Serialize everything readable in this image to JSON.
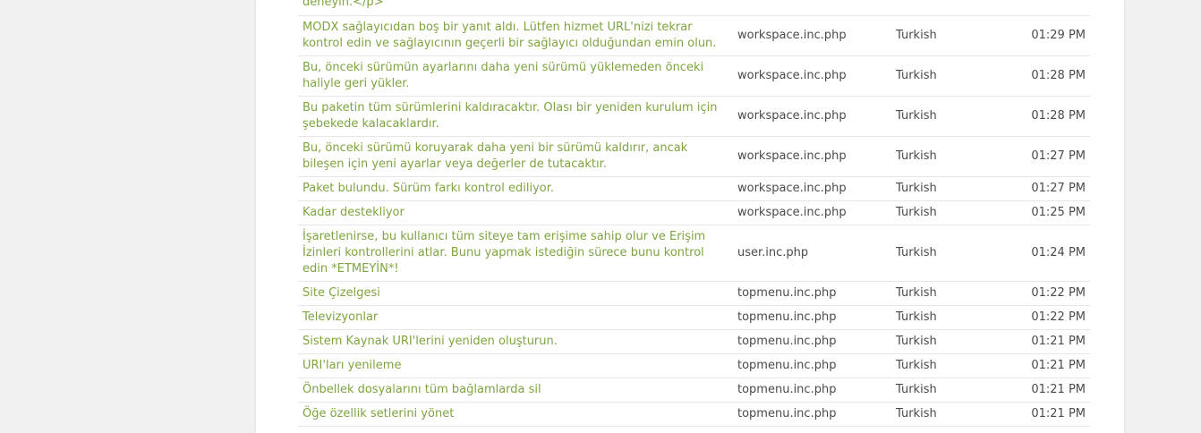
{
  "rows": [
    {
      "text": "deneyin.</p>",
      "file": "",
      "lang": "",
      "time": ""
    },
    {
      "text": "MODX sağlayıcıdan boş bir yanıt aldı. Lütfen hizmet URL'nizi tekrar kontrol edin ve sağlayıcının geçerli bir sağlayıcı olduğundan emin olun.",
      "file": "workspace.inc.php",
      "lang": "Turkish",
      "time": "01:29 PM"
    },
    {
      "text": "Bu, önceki sürümün ayarlarını daha yeni sürümü yüklemeden önceki haliyle geri yükler.",
      "file": "workspace.inc.php",
      "lang": "Turkish",
      "time": "01:28 PM"
    },
    {
      "text": "Bu paketin tüm sürümlerini kaldıracaktır. Olası bir yeniden kurulum için şebekede kalacaklardır.",
      "file": "workspace.inc.php",
      "lang": "Turkish",
      "time": "01:28 PM"
    },
    {
      "text": "Bu, önceki sürümü koruyarak daha yeni bir sürümü kaldırır, ancak bileşen için yeni ayarlar veya değerler de tutacaktır.",
      "file": "workspace.inc.php",
      "lang": "Turkish",
      "time": "01:27 PM"
    },
    {
      "text": "Paket bulundu. Sürüm farkı kontrol ediliyor.",
      "file": "workspace.inc.php",
      "lang": "Turkish",
      "time": "01:27 PM"
    },
    {
      "text": "Kadar destekliyor",
      "file": "workspace.inc.php",
      "lang": "Turkish",
      "time": "01:25 PM"
    },
    {
      "text": "İşaretlenirse, bu kullanıcı tüm siteye tam erişime sahip olur ve Erişim İzinleri kontrollerini atlar. Bunu yapmak istediğin sürece bunu kontrol edin *ETMEYİN*!",
      "file": "user.inc.php",
      "lang": "Turkish",
      "time": "01:24 PM"
    },
    {
      "text": "Site Çizelgesi",
      "file": "topmenu.inc.php",
      "lang": "Turkish",
      "time": "01:22 PM"
    },
    {
      "text": "Televizyonlar",
      "file": "topmenu.inc.php",
      "lang": "Turkish",
      "time": "01:22 PM"
    },
    {
      "text": "Sistem Kaynak URI'lerini yeniden oluşturun.",
      "file": "topmenu.inc.php",
      "lang": "Turkish",
      "time": "01:21 PM"
    },
    {
      "text": "URI'ları yenileme",
      "file": "topmenu.inc.php",
      "lang": "Turkish",
      "time": "01:21 PM"
    },
    {
      "text": "Önbellek dosyalarını tüm bağlamlarda sil",
      "file": "topmenu.inc.php",
      "lang": "Turkish",
      "time": "01:21 PM"
    },
    {
      "text": "Öğe özellik setlerini yönet",
      "file": "topmenu.inc.php",
      "lang": "Turkish",
      "time": "01:21 PM"
    }
  ]
}
